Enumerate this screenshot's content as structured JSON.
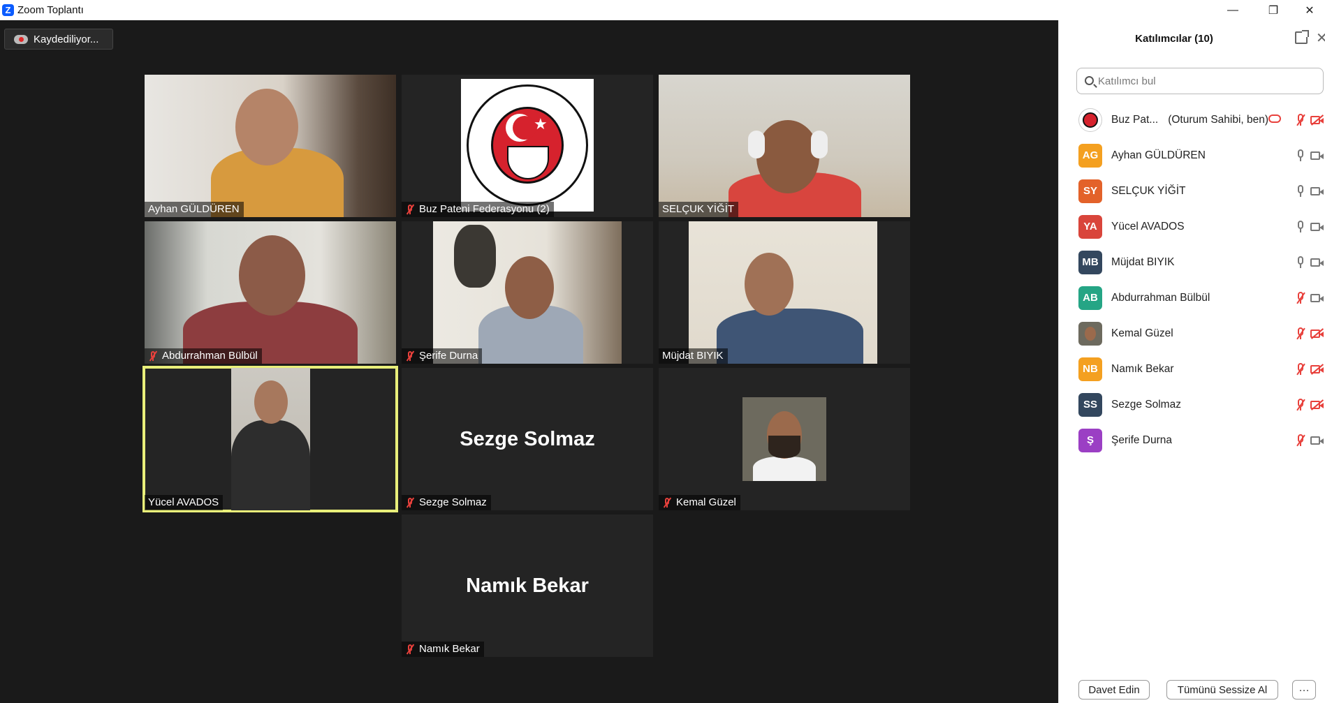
{
  "window": {
    "title": "Zoom Toplantı",
    "logo": "Z",
    "minimize": "—",
    "maximize": "❐",
    "close": "✕"
  },
  "recording": {
    "label": "Kaydediliyor..."
  },
  "tiles": [
    {
      "name": "Ayhan GÜLDÜREN",
      "muted": false,
      "video": true
    },
    {
      "name": "Buz Pateni Federasyonu (2)",
      "muted": true,
      "video": false,
      "logo": true
    },
    {
      "name": "SELÇUK YİĞİT",
      "muted": false,
      "video": true
    },
    {
      "name": "Abdurrahman Bülbül",
      "muted": true,
      "video": true
    },
    {
      "name": "Şerife Durna",
      "muted": true,
      "video": true
    },
    {
      "name": "Müjdat BIYIK",
      "muted": false,
      "video": true
    },
    {
      "name": "Yücel AVADOS",
      "muted": false,
      "video": true,
      "active": true
    },
    {
      "name": "Sezge Solmaz",
      "muted": true,
      "video": false,
      "big_name": "Sezge Solmaz"
    },
    {
      "name": "Kemal Güzel",
      "muted": true,
      "video": false,
      "photo": true
    },
    {
      "name": "Namık Bekar",
      "muted": true,
      "video": false,
      "big_name": "Namık Bekar"
    }
  ],
  "panel": {
    "title": "Katılımcılar (10)",
    "search_placeholder": "Katılımcı bul",
    "participants": [
      {
        "name": "Buz Pat...",
        "role": "(Oturum Sahibi, ben)",
        "initials": "",
        "color": "#ffffff",
        "mic_muted": true,
        "cam_off": true,
        "recording": true,
        "logo": true
      },
      {
        "name": "Ayhan GÜLDÜREN",
        "initials": "AG",
        "color": "#f4a020",
        "mic_muted": false,
        "cam_off": false
      },
      {
        "name": "SELÇUK YİĞİT",
        "initials": "SY",
        "color": "#e3622a",
        "mic_muted": false,
        "cam_off": false
      },
      {
        "name": "Yücel AVADOS",
        "initials": "YA",
        "color": "#d9453b",
        "mic_muted": false,
        "cam_off": false
      },
      {
        "name": "Müjdat BIYIK",
        "initials": "MB",
        "color": "#33475e",
        "mic_muted": false,
        "cam_off": false
      },
      {
        "name": "Abdurrahman Bülbül",
        "initials": "AB",
        "color": "#25a585",
        "mic_muted": true,
        "cam_off": false
      },
      {
        "name": "Kemal Güzel",
        "initials": "",
        "color": "#6d6a5e",
        "mic_muted": true,
        "cam_off": true,
        "photo": true
      },
      {
        "name": "Namık Bekar",
        "initials": "NB",
        "color": "#f4a020",
        "mic_muted": true,
        "cam_off": true
      },
      {
        "name": "Sezge Solmaz",
        "initials": "SS",
        "color": "#33475e",
        "mic_muted": true,
        "cam_off": true
      },
      {
        "name": "Şerife Durna",
        "initials": "Ş",
        "color": "#9b3fc4",
        "mic_muted": true,
        "cam_off": false
      }
    ],
    "footer": {
      "invite": "Davet Edin",
      "mute_all": "Tümünü Sessize Al",
      "more": "···"
    }
  }
}
